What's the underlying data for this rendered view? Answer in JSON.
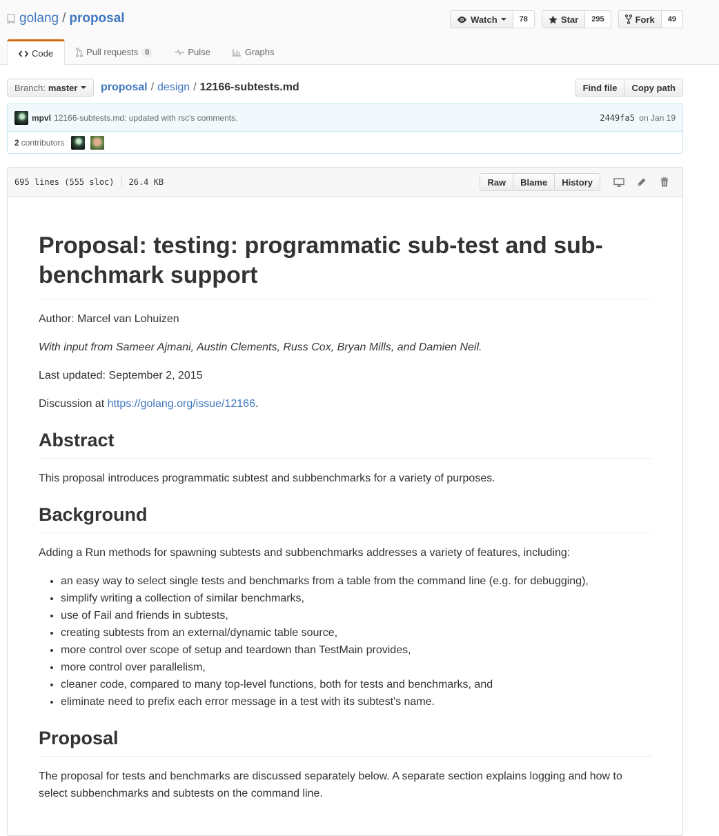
{
  "repo": {
    "owner": "golang",
    "separator": "/",
    "name": "proposal"
  },
  "actions": {
    "watch": {
      "label": "Watch",
      "count": "78"
    },
    "star": {
      "label": "Star",
      "count": "295"
    },
    "fork": {
      "label": "Fork",
      "count": "49"
    }
  },
  "nav": {
    "code": "Code",
    "pulls": "Pull requests",
    "pulls_count": "0",
    "pulse": "Pulse",
    "graphs": "Graphs"
  },
  "filenav": {
    "branch_prefix": "Branch:",
    "branch": "master",
    "breadcrumb_root": "proposal",
    "sep": "/",
    "breadcrumb_dir": "design",
    "breadcrumb_file": "12166-subtests.md",
    "find_file": "Find file",
    "copy_path": "Copy path"
  },
  "commit": {
    "author": "mpvl",
    "message": "12166-subtests.md: updated with rsc's comments.",
    "sha": "2449fa5",
    "date": "on Jan 19",
    "contributors_count": "2",
    "contributors_label": "contributors"
  },
  "file": {
    "lines": "695 lines (555 sloc)",
    "size": "26.4 KB",
    "raw": "Raw",
    "blame": "Blame",
    "history": "History"
  },
  "doc": {
    "title": "Proposal: testing: programmatic sub-test and sub-benchmark support",
    "author": "Author: Marcel van Lohuizen",
    "input": "With input from Sameer Ajmani, Austin Clements, Russ Cox, Bryan Mills, and Damien Neil.",
    "updated": "Last updated: September 2, 2015",
    "discussion_prefix": "Discussion at ",
    "discussion_link": "https://golang.org/issue/12166",
    "discussion_suffix": ".",
    "abstract_heading": "Abstract",
    "abstract_text": "This proposal introduces programmatic subtest and subbenchmarks for a variety of purposes.",
    "background_heading": "Background",
    "background_text": "Adding a Run methods for spawning subtests and subbenchmarks addresses a variety of features, including:",
    "background_items": [
      "an easy way to select single tests and benchmarks from a table from the command line (e.g. for debugging),",
      "simplify writing a collection of similar benchmarks,",
      "use of Fail and friends in subtests,",
      "creating subtests from an external/dynamic table source,",
      "more control over scope of setup and teardown than TestMain provides,",
      "more control over parallelism,",
      "cleaner code, compared to many top-level functions, both for tests and benchmarks, and",
      "eliminate need to prefix each error message in a test with its subtest's name."
    ],
    "proposal_heading": "Proposal",
    "proposal_text": "The proposal for tests and benchmarks are discussed separately below. A separate section explains logging and how to select subbenchmarks and subtests on the command line."
  },
  "colors": {
    "link": "#4078c0",
    "tab_accent": "#d26911",
    "commit_bg": "#f2f9fc"
  }
}
